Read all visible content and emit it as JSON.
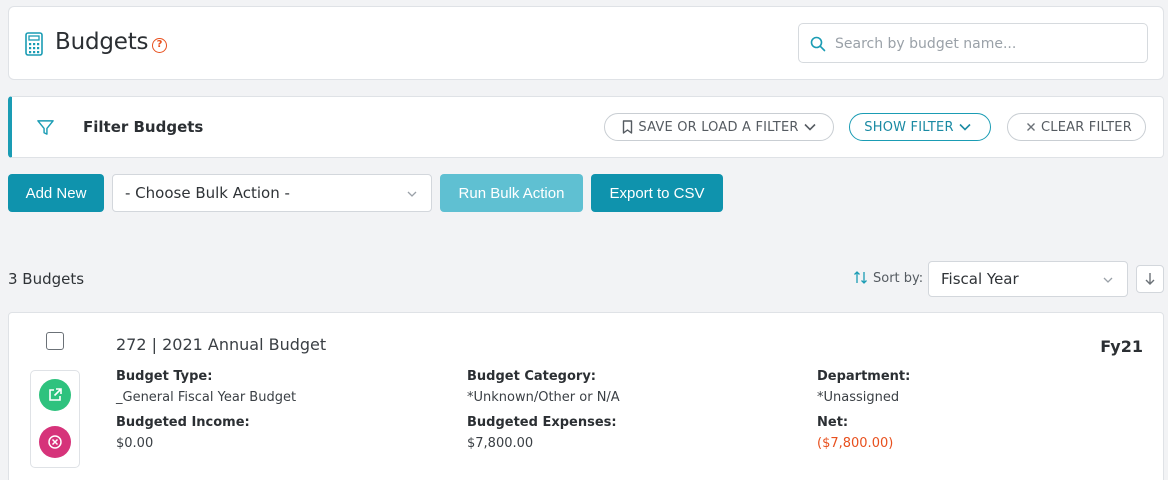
{
  "header": {
    "title": "Budgets",
    "help_glyph": "?",
    "search_placeholder": "Search by budget name..."
  },
  "filter": {
    "title": "Filter Budgets",
    "save_load_label": "SAVE OR LOAD A FILTER",
    "show_label": "SHOW FILTER",
    "clear_label": "CLEAR FILTER"
  },
  "actions": {
    "add_new": "Add New",
    "bulk_select_value": "- Choose Bulk Action -",
    "run_bulk": "Run Bulk Action",
    "export_csv": "Export to CSV"
  },
  "list": {
    "count_label": "3 Budgets",
    "sort_by_label": "Sort by:",
    "sort_value": "Fiscal Year"
  },
  "budgets": [
    {
      "name": "272 | 2021 Annual Budget",
      "fiscal_tag": "Fy21",
      "fields": {
        "type_label": "Budget Type:",
        "type_value": "_General Fiscal Year Budget",
        "category_label": "Budget Category:",
        "category_value": "*Unknown/Other or N/A",
        "department_label": "Department:",
        "department_value": "*Unassigned",
        "income_label": "Budgeted Income:",
        "income_value": "$0.00",
        "expenses_label": "Budgeted Expenses:",
        "expenses_value": "$7,800.00",
        "net_label": "Net:",
        "net_value": "($7,800.00)"
      }
    }
  ],
  "icons": {
    "title": "calculator-icon",
    "help": "help-circle-icon",
    "search": "search-icon",
    "filter": "funnel-icon",
    "bookmark": "bookmark-icon",
    "chevron": "chevron-down-icon",
    "clear": "close-icon",
    "sort": "sort-arrows-icon",
    "sort_direction": "arrow-down-icon",
    "open": "external-link-icon",
    "delete": "close-circle-icon"
  },
  "colors": {
    "accent": "#0f93ad",
    "accent_light": "#5fc0d2",
    "negative": "#e8501e",
    "open_green": "#2ec27e",
    "delete_pink": "#d6337a"
  }
}
